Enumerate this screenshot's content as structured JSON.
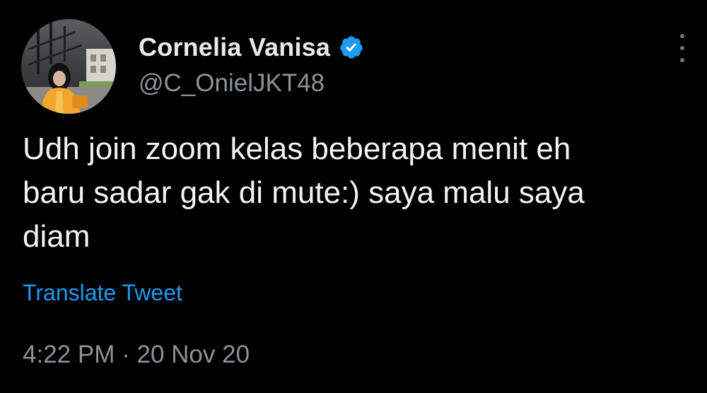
{
  "tweet": {
    "author": {
      "display_name": "Cornelia Vanisa",
      "handle": "@C_OnielJKT48",
      "verified": true
    },
    "text_lines": [
      "Udh join zoom kelas beberapa menit eh",
      "baru sadar gak di mute:) saya malu saya",
      "diam"
    ],
    "translate_label": "Translate Tweet",
    "time": "4:22 PM",
    "separator": "·",
    "date": "20 Nov 20"
  },
  "icons": {
    "verified": "verified-badge-icon",
    "more": "more-options-icon"
  },
  "colors": {
    "background": "#000000",
    "primary_text": "#e7e9ea",
    "secondary_text": "#8b9298",
    "link": "#1d9bf0",
    "verified_badge": "#1d9bf0"
  }
}
